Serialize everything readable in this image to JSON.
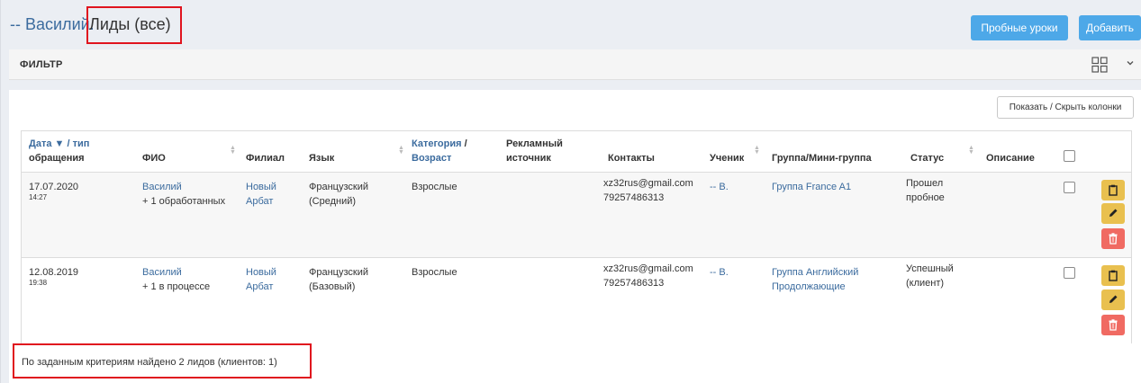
{
  "header": {
    "user_link": "-- Василий.",
    "title": "Лиды (все)",
    "trial_button": "Пробные уроки",
    "add_button": "Добавить"
  },
  "filter": {
    "title": "ФИЛЬТР",
    "toggle_icon": "grid-icon",
    "expand_icon": "chevron-down-icon"
  },
  "columns_button": "Показать / Скрыть колонки",
  "table": {
    "headers": {
      "date_a": "Дата ▼",
      "date_b": " / тип",
      "date_c": "обращения",
      "fio": "ФИО",
      "branch": "Филиал",
      "language": "Язык",
      "category_a": "Категория",
      "category_b": " /",
      "category_c": "Возраст",
      "source_a": "Рекламный",
      "source_b": "источник",
      "contacts": "Контакты",
      "student": "Ученик",
      "group": "Группа/Мини-группа",
      "status": "Статус",
      "description": "Описание"
    },
    "rows": [
      {
        "date": "17.07.2020",
        "time": "14:27",
        "fio": "Василий",
        "fio_note": "+ 1 обработанных",
        "branch_1": "Новый",
        "branch_2": "Арбат",
        "language_1": "Французский",
        "language_2": "(Средний)",
        "category": "Взрослые",
        "email": "xz32rus@gmail.com",
        "phone": "79257486313",
        "student": "-- В.",
        "group_1": "Группа France A1",
        "group_2": "",
        "status_1": "Прошел",
        "status_2": "пробное"
      },
      {
        "date": "12.08.2019",
        "time": "19:38",
        "fio": "Василий",
        "fio_note": "+ 1 в процессе",
        "branch_1": "Новый",
        "branch_2": "Арбат",
        "language_1": "Французский",
        "language_2": "(Базовый)",
        "category": "Взрослые",
        "email": "xz32rus@gmail.com",
        "phone": "79257486313",
        "student": "-- В.",
        "group_1": "Группа Английский",
        "group_2": "Продолжающие",
        "status_1": "Успешный",
        "status_2": "(клиент)"
      }
    ],
    "actions": [
      "clipboard-icon",
      "pencil-icon",
      "trash-icon"
    ]
  },
  "footer": {
    "summary": "По заданным критериям найдено 2 лидов (клиентов: 1)"
  },
  "colors": {
    "accent_blue": "#4da8e8",
    "link": "#3b6b9e",
    "edit_yellow": "#e9c04f",
    "delete_red": "#f06a62",
    "highlight_red": "#e0141e"
  }
}
